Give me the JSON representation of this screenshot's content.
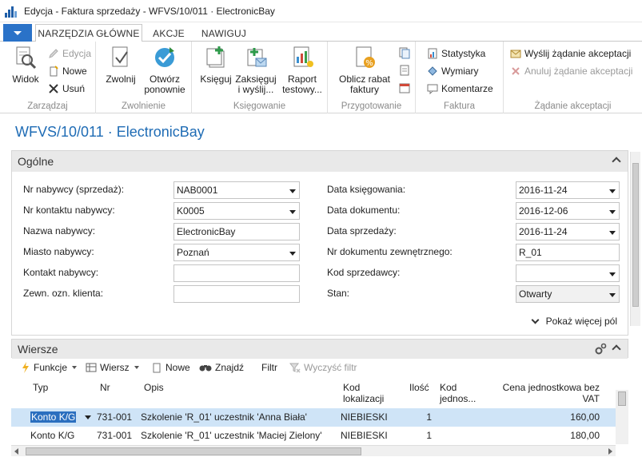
{
  "window": {
    "title": "Edycja - Faktura sprzedaży - WFVS/10/011 · ElectronicBay"
  },
  "ribbon": {
    "tabs": [
      {
        "label": "NARZĘDZIA GŁÓWNE"
      },
      {
        "label": "AKCJE"
      },
      {
        "label": "NAWIGUJ"
      }
    ],
    "zarzadzaj": {
      "label": "Zarządzaj",
      "widok": "Widok",
      "edycja": "Edycja",
      "nowe": "Nowe",
      "usun": "Usuń"
    },
    "zwolnienie": {
      "label": "Zwolnienie",
      "zwolnij": "Zwolnij",
      "otworz_1": "Otwórz",
      "otworz_2": "ponownie"
    },
    "ksiegowanie": {
      "label": "Księgowanie",
      "ksieguj": "Księguj",
      "zaksieguj_1": "Zaksięguj",
      "zaksieguj_2": "i wyślij...",
      "raport_1": "Raport",
      "raport_2": "testowy..."
    },
    "przygotowanie": {
      "label": "Przygotowanie",
      "oblicz_1": "Oblicz rabat",
      "oblicz_2": "faktury"
    },
    "faktura": {
      "label": "Faktura",
      "statystyka": "Statystyka",
      "wymiary": "Wymiary",
      "komentarze": "Komentarze"
    },
    "akceptacja": {
      "label": "Żądanie akceptacji",
      "wyslij": "Wyślij żądanie akceptacji",
      "anuluj": "Anuluj żądanie akceptacji"
    }
  },
  "page_title": "WFVS/10/011 · ElectronicBay",
  "general": {
    "header": "Ogólne",
    "left": [
      {
        "label": "Nr nabywcy (sprzedaż):",
        "value": "NAB0001",
        "dropdown": true
      },
      {
        "label": "Nr kontaktu nabywcy:",
        "value": "K0005",
        "dropdown": true
      },
      {
        "label": "Nazwa nabywcy:",
        "value": "ElectronicBay",
        "dropdown": false
      },
      {
        "label": "Miasto nabywcy:",
        "value": "Poznań",
        "dropdown": true
      },
      {
        "label": "Kontakt nabywcy:",
        "value": "",
        "dropdown": false
      },
      {
        "label": "Zewn. ozn. klienta:",
        "value": "",
        "dropdown": false
      }
    ],
    "right": [
      {
        "label": "Data księgowania:",
        "value": "2016-11-24",
        "dropdown": true
      },
      {
        "label": "Data dokumentu:",
        "value": "2016-12-06",
        "dropdown": true
      },
      {
        "label": "Data sprzedaży:",
        "value": "2016-11-24",
        "dropdown": true
      },
      {
        "label": "Nr dokumentu zewnętrznego:",
        "value": "R_01",
        "dropdown": false
      },
      {
        "label": "Kod sprzedawcy:",
        "value": "",
        "dropdown": true
      },
      {
        "label": "Stan:",
        "value": "Otwarty",
        "dropdown": true
      }
    ],
    "show_more": "Pokaż więcej pól"
  },
  "lines": {
    "header": "Wiersze",
    "toolbar": {
      "funkcje": "Funkcje",
      "wiersz": "Wiersz",
      "nowe": "Nowe",
      "znajdz": "Znajdź",
      "filtr": "Filtr",
      "wyczysc": "Wyczyść filtr"
    },
    "columns": {
      "typ": "Typ",
      "nr": "Nr",
      "opis": "Opis",
      "kod_lok_1": "Kod",
      "kod_lok_2": "lokalizacji",
      "ilosc": "Ilość",
      "kod_jedn_1": "Kod",
      "kod_jedn_2": "jednos...",
      "cena_1": "Cena jednostkowa bez",
      "cena_2": "VAT"
    },
    "rows": [
      {
        "typ": "Konto K/G",
        "nr": "731-001",
        "opis": "Szkolenie 'R_01' uczestnik 'Anna Biała'",
        "lok": "NIEBIESKI",
        "ilosc": "1",
        "jedn": "",
        "cena": "160,00"
      },
      {
        "typ": "Konto K/G",
        "nr": "731-001",
        "opis": "Szkolenie 'R_01' uczestnik 'Maciej Zielony'",
        "lok": "NIEBIESKI",
        "ilosc": "1",
        "jedn": "",
        "cena": "180,00"
      }
    ]
  },
  "colors": {
    "accent": "#2a72c8",
    "title_blue": "#1f6cb5",
    "selected_row": "#cfe4f7"
  }
}
